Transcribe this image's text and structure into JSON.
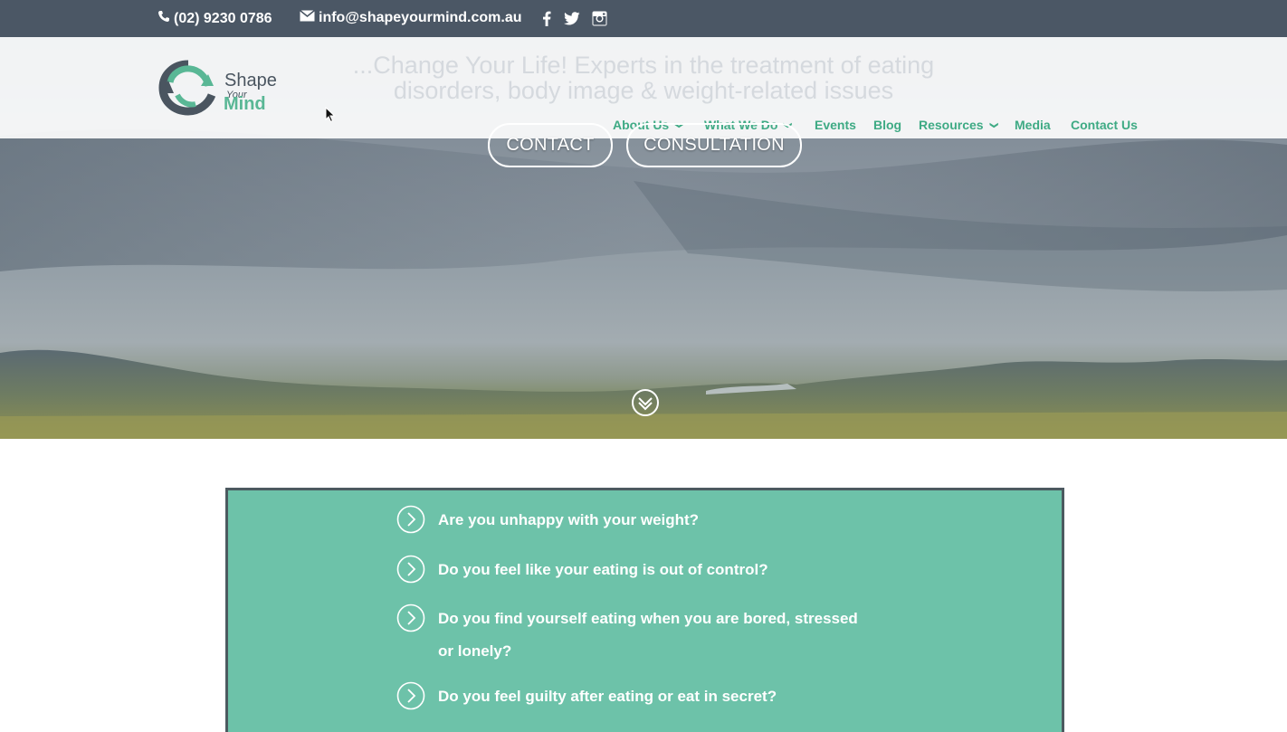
{
  "topbar": {
    "phone": "(02) 9230 0786",
    "email": "info@shapeyourmind.com.au",
    "social": [
      "facebook-icon",
      "twitter-icon",
      "instagram-icon"
    ]
  },
  "logo": {
    "shape": "Shape",
    "your": "Your",
    "mind": "Mind"
  },
  "nav": {
    "items": [
      {
        "label": "About Us",
        "has_dropdown": true
      },
      {
        "label": "What We Do",
        "has_dropdown": true
      },
      {
        "label": "Events",
        "has_dropdown": false
      },
      {
        "label": "Blog",
        "has_dropdown": false
      },
      {
        "label": "Resources",
        "has_dropdown": true
      },
      {
        "label": "Media",
        "has_dropdown": false
      },
      {
        "label": "Contact Us",
        "has_dropdown": false
      }
    ]
  },
  "hero": {
    "tagline": "...Change Your Life! Experts in the treatment of eating disorders, body image & weight-related issues",
    "buttons": {
      "contact": "CONTACT",
      "consultation": "CONSULTATION"
    }
  },
  "questions": [
    "Are you unhappy with your weight?",
    "Do you feel like your eating is out of control?",
    "Do you find yourself eating when you are bored, stressed or lonely?",
    "Do you feel guilty after eating or eat in secret?"
  ],
  "colors": {
    "accent": "#3eaa84",
    "box": "#6dc2a9",
    "topbar": "#485462"
  }
}
